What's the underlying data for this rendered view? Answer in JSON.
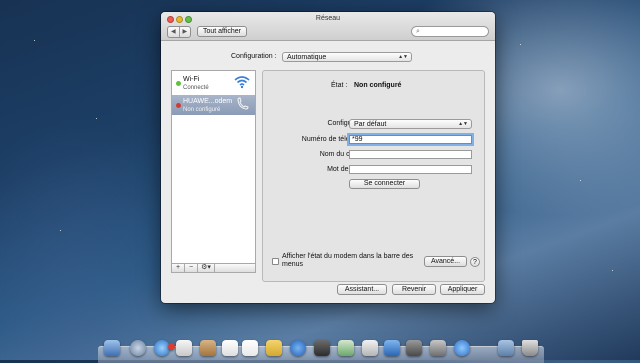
{
  "window": {
    "title": "Réseau",
    "show_all_label": "Tout afficher",
    "nav_back": "◀",
    "nav_forward": "▶",
    "search_placeholder": ""
  },
  "location": {
    "label": "Configuration :",
    "value": "Automatique"
  },
  "services": [
    {
      "name": "Wi-Fi",
      "status": "Connecté",
      "dot": "green",
      "icon": "wifi-icon"
    },
    {
      "name": "HUAWE...odem",
      "status": "Non configuré",
      "dot": "red",
      "icon": "phone-icon"
    }
  ],
  "sidebar_controls": {
    "add": "+",
    "remove": "−",
    "gear": "⚙▾"
  },
  "detail": {
    "status_label": "État :",
    "status_value": "Non configuré",
    "config_label": "Configuration :",
    "config_value": "Par défaut",
    "phone_label": "Numéro de téléphone :",
    "phone_value": "*99",
    "account_label": "Nom du compte :",
    "account_value": "",
    "password_label": "Mot de passe :",
    "password_value": "",
    "connect_label": "Se connecter",
    "menubar_checkbox_label": "Afficher l'état du modem dans la barre des menus",
    "advanced_label": "Avancé...",
    "help_label": "?"
  },
  "footer": {
    "assistant_label": "Assistant...",
    "revert_label": "Revenir",
    "apply_label": "Appliquer"
  },
  "colors": {
    "selected_row": "#8a9bb6",
    "status_green": "#5cc13e",
    "status_red": "#d33b2f",
    "focus_ring": "#7fb0ea"
  }
}
